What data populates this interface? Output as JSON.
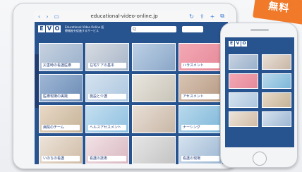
{
  "badge": {
    "text": "無料"
  },
  "ipad": {
    "url": "educational-video-online.jp",
    "logo": [
      "E",
      "V",
      "O"
    ],
    "site_tagline": "Educational Video Online 医療福祉を促進するサービス",
    "search_placeholder": "Q",
    "cards": [
      {
        "caption": "災害時の看護医療",
        "colors": [
          "#c7d2e0",
          "#9ab1cc"
        ]
      },
      {
        "caption": "在宅ケアの基本",
        "colors": [
          "#d8dce2",
          "#a7b5c9"
        ]
      },
      {
        "caption": "",
        "colors": [
          "#bdd0e6",
          "#8aa7c7"
        ]
      },
      {
        "caption": "ハラスメント",
        "colors": [
          "#f4a8b3",
          "#e58a9a"
        ]
      },
      {
        "caption": "医療現場の実践",
        "colors": [
          "#9fb7d6",
          "#6d8db5"
        ]
      },
      {
        "caption": "施設と介護",
        "colors": [
          "#d4e2ef",
          "#aec7df"
        ]
      },
      {
        "caption": "",
        "colors": [
          "#e9e6df",
          "#c9c4b8"
        ]
      },
      {
        "caption": "アセスメント",
        "colors": [
          "#d8c4b3",
          "#b69a83"
        ]
      },
      {
        "caption": "病院のチーム",
        "colors": [
          "#e8d9c7",
          "#c6b398"
        ]
      },
      {
        "caption": "ヘルスアセスメント",
        "colors": [
          "#c4dff0",
          "#8fc0e0"
        ]
      },
      {
        "caption": "",
        "colors": [
          "#e9dfd6",
          "#c8b7a6"
        ]
      },
      {
        "caption": "ナーシング",
        "colors": [
          "#b8d9ec",
          "#7eb7d9"
        ]
      },
      {
        "caption": "いのちの看護",
        "colors": [
          "#ece3d9",
          "#d0bca6"
        ]
      },
      {
        "caption": "看護の技術",
        "colors": [
          "#f1e2e6",
          "#d9b8c1"
        ]
      },
      {
        "caption": "",
        "colors": [
          "#e6e6e6",
          "#c4c4c4"
        ]
      },
      {
        "caption": "看護の現場",
        "colors": [
          "#d5e2ef",
          "#9db7d2"
        ]
      }
    ]
  },
  "iphone": {
    "logo": [
      "E",
      "V",
      "O"
    ],
    "cards": [
      {
        "colors": [
          "#c7d2e0",
          "#9ab1cc"
        ]
      },
      {
        "colors": [
          "#e9dfd6",
          "#c8b7a6"
        ]
      },
      {
        "colors": [
          "#f4a8b3",
          "#e58a9a"
        ]
      },
      {
        "colors": [
          "#b8d9ec",
          "#7eb7d9"
        ]
      },
      {
        "colors": [
          "#d4e2ef",
          "#aec7df"
        ]
      },
      {
        "colors": [
          "#e8d9c7",
          "#c6b398"
        ]
      },
      {
        "colors": [
          "#ece3d9",
          "#d0bca6"
        ]
      },
      {
        "colors": [
          "#d5e2ef",
          "#9db7d2"
        ]
      }
    ]
  }
}
